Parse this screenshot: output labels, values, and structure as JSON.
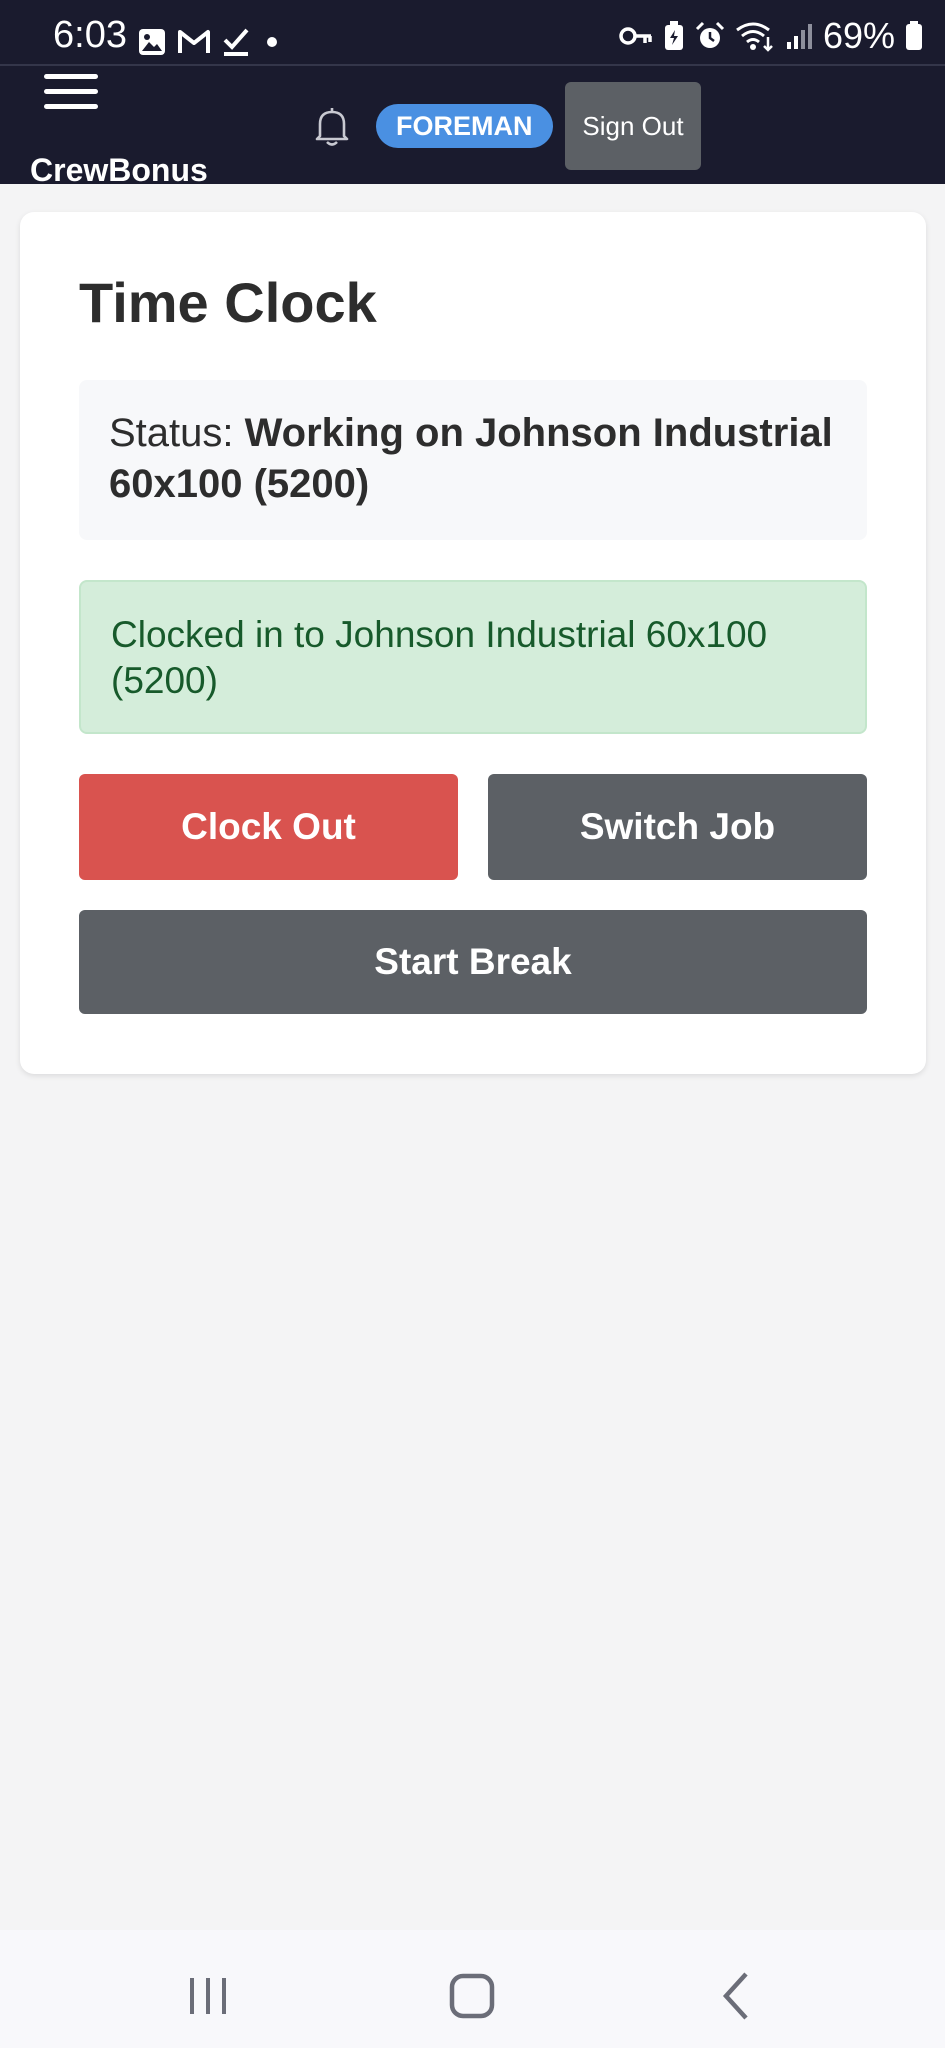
{
  "status_bar": {
    "time": "6:03",
    "battery_percent": "69%",
    "left_icons": [
      "image-icon",
      "gmail-icon",
      "check-icon",
      "dot-icon"
    ],
    "right_icons": [
      "key-icon",
      "battery-saver-icon",
      "alarm-icon",
      "wifi-icon",
      "signal-icon",
      "battery-icon"
    ]
  },
  "header": {
    "brand": "CrewBonus",
    "role_badge": "FOREMAN",
    "sign_out_label": "Sign Out",
    "accent_color": "#4a90e2",
    "background_color": "#1a1b2e"
  },
  "time_clock": {
    "title": "Time Clock",
    "status_label": "Status:",
    "status_value": "Working on Johnson Industrial 60x100 (5200)",
    "alert_message": "Clocked in to Johnson Industrial 60x100 (5200)",
    "buttons": {
      "clock_out": "Clock Out",
      "switch_job": "Switch Job",
      "start_break": "Start Break"
    },
    "colors": {
      "clock_out": "#d9534f",
      "secondary": "#5c6065",
      "alert_background": "#d4edda",
      "alert_text": "#175a2b"
    }
  },
  "nav_bar": {
    "icons": [
      "recent-apps-icon",
      "home-icon",
      "back-icon"
    ]
  }
}
